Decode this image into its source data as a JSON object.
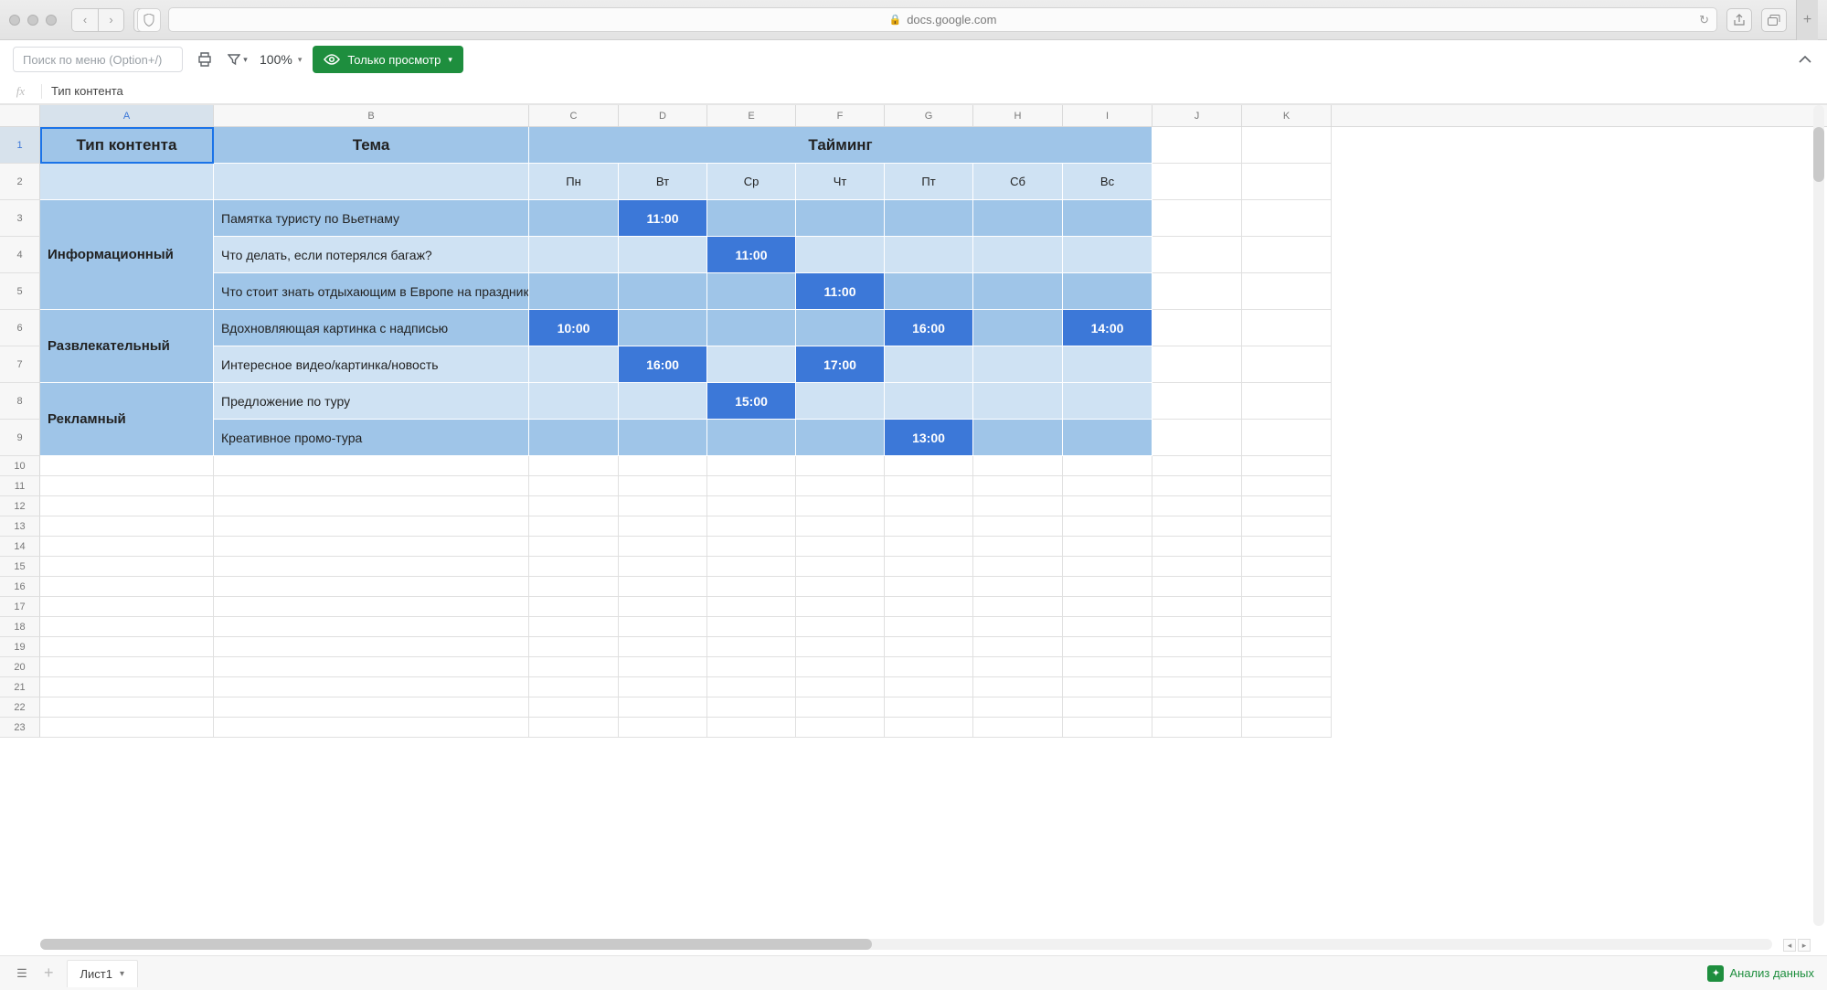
{
  "browser": {
    "url": "docs.google.com"
  },
  "toolbar": {
    "search_placeholder": "Поиск по меню (Option+/)",
    "zoom": "100%",
    "view_button": "Только просмотр"
  },
  "fx": {
    "label": "fx",
    "value": "Тип контента"
  },
  "columns": [
    "A",
    "B",
    "C",
    "D",
    "E",
    "F",
    "G",
    "H",
    "I",
    "J",
    "K"
  ],
  "col_widths": {
    "A": 190,
    "B": 345,
    "C": 98,
    "D": 97,
    "E": 97,
    "F": 97,
    "G": 97,
    "H": 98,
    "I": 98,
    "J": 98,
    "K": 98
  },
  "headers": {
    "type": "Тип контента",
    "theme": "Тема",
    "timing": "Тайминг"
  },
  "days": [
    "Пн",
    "Вт",
    "Ср",
    "Чт",
    "Пт",
    "Сб",
    "Вс"
  ],
  "content_types": [
    {
      "name": "Информационный",
      "rowspan": 3
    },
    {
      "name": "Развлекательный",
      "rowspan": 2
    },
    {
      "name": "Рекламный",
      "rowspan": 2
    }
  ],
  "data_rows": [
    {
      "row": 3,
      "type_idx": 0,
      "alt": false,
      "theme": "Памятка туристу по Вьетнаму",
      "times": {
        "D": "11:00"
      }
    },
    {
      "row": 4,
      "type_idx": 0,
      "alt": true,
      "theme": "Что делать, если потерялся багаж?",
      "times": {
        "E": "11:00"
      }
    },
    {
      "row": 5,
      "type_idx": 0,
      "alt": false,
      "theme": "Что стоит знать отдыхающим в Европе на праздники",
      "times": {
        "F": "11:00"
      }
    },
    {
      "row": 6,
      "type_idx": 1,
      "alt": false,
      "theme": "Вдохновляющая картинка с надписью",
      "times": {
        "C": "10:00",
        "G": "16:00",
        "I": "14:00"
      }
    },
    {
      "row": 7,
      "type_idx": 1,
      "alt": true,
      "theme": "Интересное видео/картинка/новость",
      "times": {
        "D": "16:00",
        "F": "17:00"
      }
    },
    {
      "row": 8,
      "type_idx": 2,
      "alt": true,
      "theme": "Предложение по туру",
      "times": {
        "E": "15:00"
      }
    },
    {
      "row": 9,
      "type_idx": 2,
      "alt": false,
      "theme": "Креативное промо-тура",
      "times": {
        "G": "13:00"
      }
    }
  ],
  "empty_rows": [
    10,
    11,
    12,
    13,
    14,
    15,
    16,
    17,
    18,
    19,
    20,
    21,
    22,
    23
  ],
  "sheet_tab": "Лист1",
  "analyze_button": "Анализ данных",
  "selected_cell": {
    "row": 1,
    "col": "A"
  }
}
